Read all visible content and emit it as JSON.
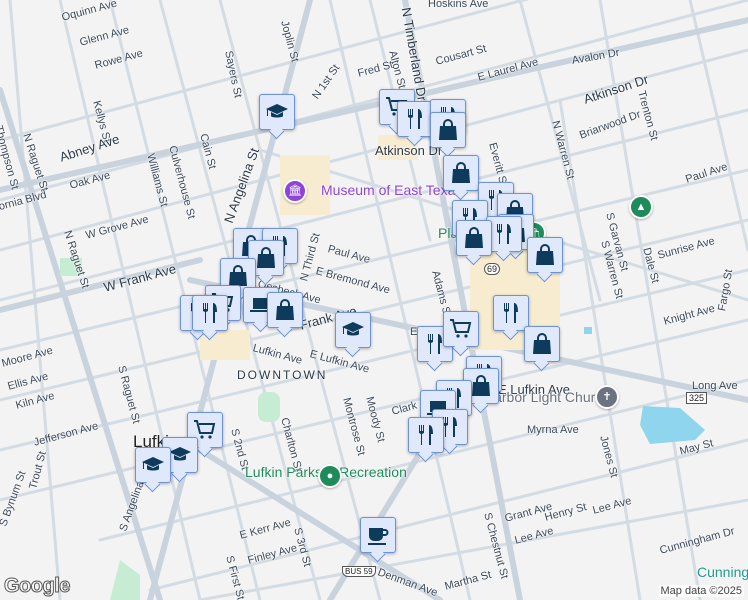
{
  "map": {
    "neighborhood": "DOWNTOWN",
    "city_label": "Lufkin",
    "streets": [
      "Oquinn Ave",
      "Glenn Ave",
      "Rowe Ave",
      "Sayers St",
      "Joplin St",
      "Kellys St",
      "Cain St",
      "Culverhouse St",
      "Williams St",
      "Thompson St",
      "N Raguet St",
      "Abney Ave",
      "Oak Ave",
      "fornia Blvd",
      "W Grove Ave",
      "N Raguet St",
      "W Frank Ave",
      "N Angelina St",
      "N 1st St",
      "Fred St",
      "Alton St",
      "N Timberland Dr",
      "Cousart St",
      "E Laurel Ave",
      "Avalon Dr",
      "Atkinson Dr",
      "Atkinson Dr",
      "Trenton St",
      "Briarwood Dr",
      "N Warren St",
      "Everitt St",
      "Paul Ave",
      "S Garvan St",
      "Dale St",
      "Sunrise Ave",
      "S Warren St",
      "Adams St",
      "Paul Ave",
      "E Bremond Ave",
      "Oesbeck Ave",
      "N Third St",
      "Knight Ave",
      "Fargo St",
      "Moore Ave",
      "Ellis Ave",
      "Kiln Ave",
      "Jefferson Ave",
      "S Raguet St",
      "S Bynum St",
      "Trout St",
      "S Angelina St",
      "E Lufkin Ave",
      "Montrose St",
      "Moody St",
      "Charlton St",
      "S 2nd St",
      "S First St",
      "S 3rd St",
      "E Kerr Ave",
      "Finley Ave",
      "E Lufkin Ave",
      "Long Ave",
      "Myrna Ave",
      "Jones St",
      "May St",
      "Grant Ave",
      "Henry St",
      "Lee Ave",
      "Lee Ave",
      "Cunningham Dr",
      "S Chestnut St",
      "Martha St",
      "Denman Ave",
      "Clark",
      "Hoskins Ave",
      "E Grove",
      "Frank Ave",
      "Lufkin Ave"
    ],
    "pois": [
      {
        "name": "Museum of East Texas",
        "color": "#8e44d6",
        "icon": "museum-icon"
      },
      {
        "name": "Lufkin Parks & Recreation",
        "color": "#1e8c5a",
        "icon": "park-pin-icon"
      },
      {
        "name": "Pla",
        "color": "#1e8c5a",
        "icon": "shopping-pin-icon"
      },
      {
        "name": "Harbor Light Church",
        "color": "#6b7380",
        "icon": "church-icon"
      },
      {
        "name": "Cunningh",
        "color": "#1d9a8a",
        "icon": "place-icon"
      },
      {
        "name": "",
        "color": "#1e8c5a",
        "icon": "tree-icon"
      }
    ],
    "shields": [
      "69",
      "325",
      "BUS 59"
    ],
    "attribution": "Map data ©2025",
    "logo": "Google"
  },
  "markers": [
    "school",
    "cart",
    "restaurant",
    "restaurant",
    "bag",
    "bag",
    "restaurant",
    "bag",
    "restaurant",
    "bag",
    "restaurant",
    "bag",
    "bag",
    "bag",
    "restaurant",
    "bag",
    "bag",
    "cart",
    "restaurant",
    "restaurant",
    "laptop",
    "bag",
    "school",
    "restaurant",
    "cart",
    "restaurant",
    "bag",
    "restaurant",
    "bag",
    "restaurant",
    "laptop",
    "restaurant",
    "restaurant",
    "cart",
    "school",
    "school",
    "coffee"
  ]
}
